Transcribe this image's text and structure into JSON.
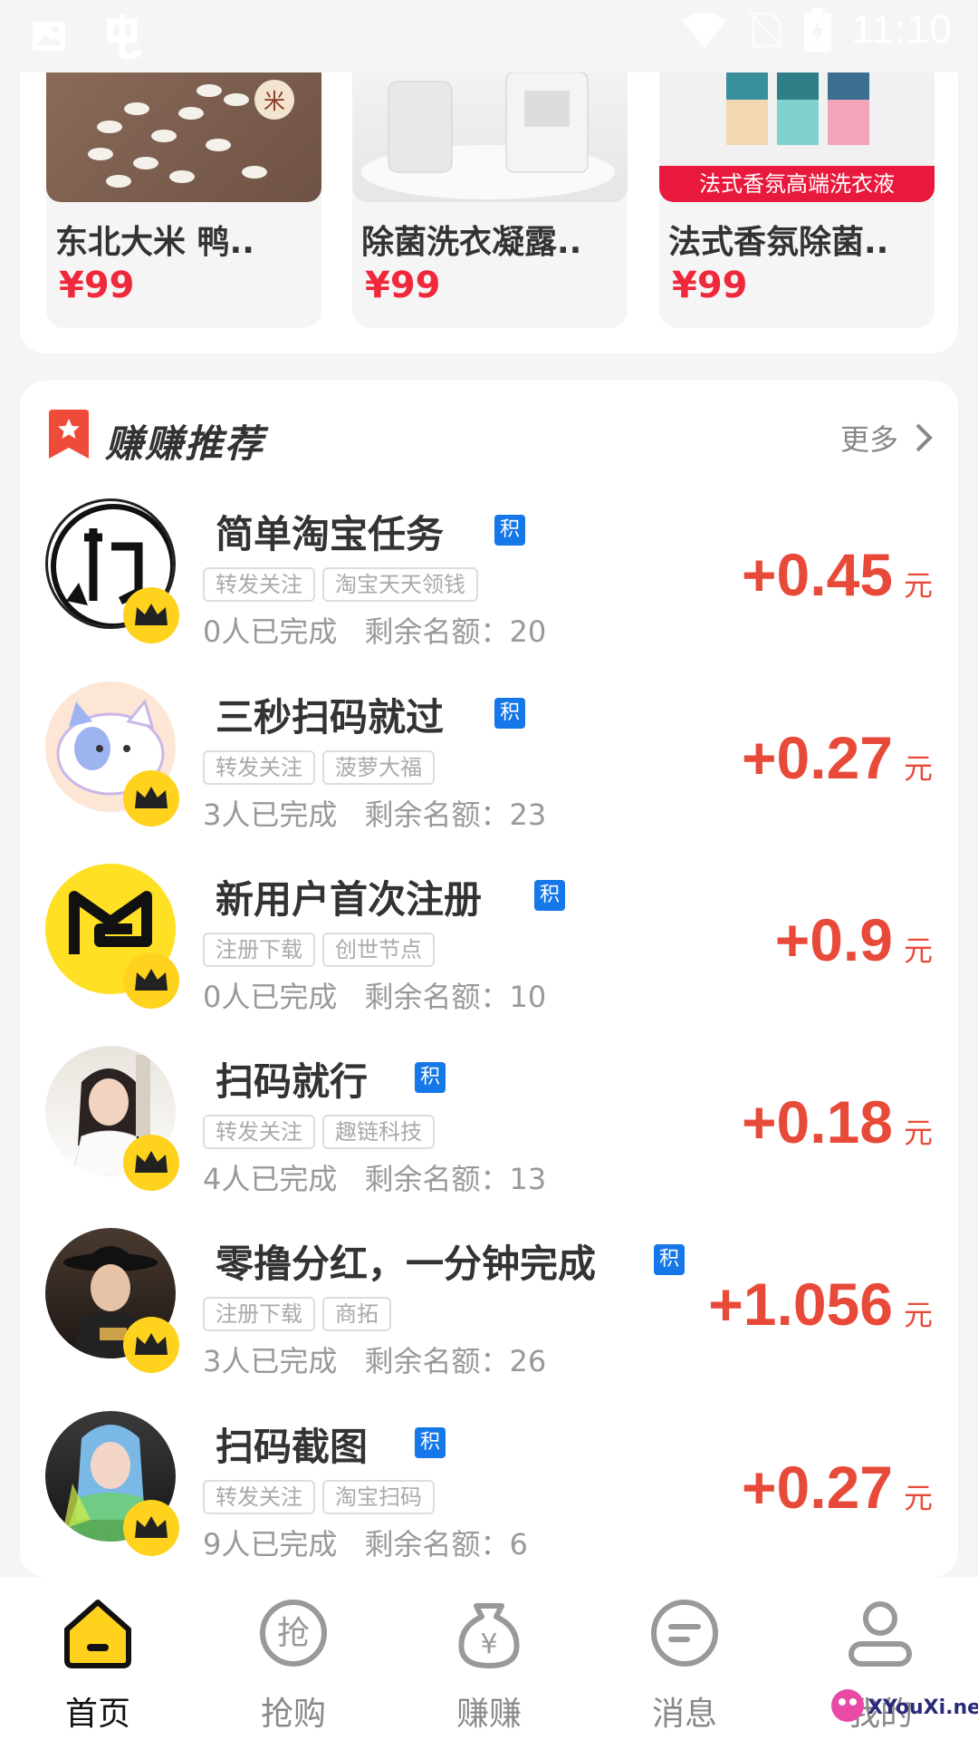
{
  "status_bar": {
    "time": "11:10"
  },
  "products": [
    {
      "title": "东北大米 鸭..",
      "price": "¥99",
      "image_label": "米"
    },
    {
      "title": "除菌洗衣凝露..",
      "price": "¥99"
    },
    {
      "title": "法式香氛除菌..",
      "price": "¥99",
      "banner": "法式香氛高端洗衣液"
    }
  ],
  "recommend": {
    "title": "赚赚推荐",
    "more": "更多",
    "badge": "积",
    "unit": "元",
    "tasks": [
      {
        "title": "简单淘宝任务",
        "tags": [
          "转发关注",
          "淘宝天天领钱"
        ],
        "completed": "0人已完成",
        "remaining": "剩余名额：20",
        "reward": "+0.45"
      },
      {
        "title": "三秒扫码就过",
        "tags": [
          "转发关注",
          "菠萝大福"
        ],
        "completed": "3人已完成",
        "remaining": "剩余名额：23",
        "reward": "+0.27"
      },
      {
        "title": "新用户首次注册",
        "tags": [
          "注册下载",
          "创世节点"
        ],
        "completed": "0人已完成",
        "remaining": "剩余名额：10",
        "reward": "+0.9"
      },
      {
        "title": "扫码就行",
        "tags": [
          "转发关注",
          "趣链科技"
        ],
        "completed": "4人已完成",
        "remaining": "剩余名额：13",
        "reward": "+0.18"
      },
      {
        "title": "零撸分红，一分钟完成",
        "tags": [
          "注册下载",
          "商拓"
        ],
        "completed": "3人已完成",
        "remaining": "剩余名额：26",
        "reward": "+1.056"
      },
      {
        "title": "扫码截图",
        "tags": [
          "转发关注",
          "淘宝扫码"
        ],
        "completed": "9人已完成",
        "remaining": "剩余名额：6",
        "reward": "+0.27"
      }
    ]
  },
  "bottom_nav": [
    {
      "label": "首页",
      "icon": "home-icon",
      "active": true
    },
    {
      "label": "抢购",
      "icon": "grab-icon"
    },
    {
      "label": "赚赚",
      "icon": "money-bag-icon"
    },
    {
      "label": "消息",
      "icon": "message-icon"
    },
    {
      "label": "我的",
      "icon": "profile-icon"
    }
  ],
  "watermark": {
    "text": "XYouXi.net"
  },
  "colors": {
    "price": "#f0283c",
    "reward": "#e84a3a",
    "badge": "#1677e8",
    "crown": "#ffd21e",
    "active_nav": "#ffd21e"
  }
}
